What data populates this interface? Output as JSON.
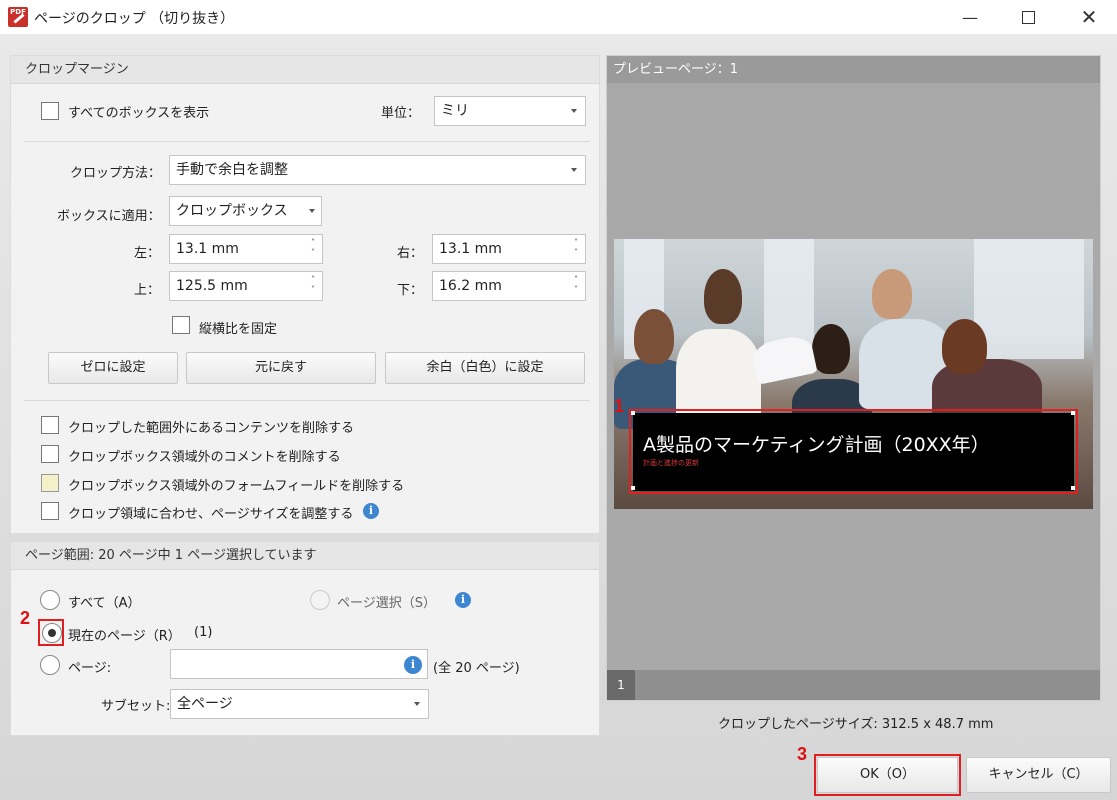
{
  "window": {
    "title": "ページのクロップ （切り抜き）",
    "app_icon_text": "PDF"
  },
  "crop_margin": {
    "header": "クロップマージン",
    "show_all_boxes_label": "すべてのボックスを表示",
    "unit_label": "単位：",
    "unit_value": "ミリ",
    "crop_method_label": "クロップ方法：",
    "crop_method_value": "手動で余白を調整",
    "apply_box_label": "ボックスに適用：",
    "apply_box_value": "クロップボックス",
    "left_label": "左：",
    "left_value": "13.1 mm",
    "right_label": "右：",
    "right_value": "13.1 mm",
    "top_label": "上：",
    "top_value": "125.5 mm",
    "bottom_label": "下：",
    "bottom_value": "16.2 mm",
    "keep_ratio_label": "縦横比を固定",
    "btn_zero": "ゼロに設定",
    "btn_reset": "元に戻す",
    "btn_white": "余白（白色）に設定",
    "opt1": "クロップした範囲外にあるコンテンツを削除する",
    "opt2": "クロップボックス領域外のコメントを削除する",
    "opt3": "クロップボックス領域外のフォームフィールドを削除する",
    "opt4": "クロップ領域に合わせ、ページサイズを調整する"
  },
  "page_range": {
    "header": "ページ範囲: 20 ページ中 1 ページ選択しています",
    "all_label": "すべて（A）",
    "select_label": "ページ選択（S）",
    "current_label": "現在のページ（R）",
    "current_count": "(1)",
    "pages_label": "ページ:",
    "pages_input": "",
    "pages_total": "(全 20 ページ)",
    "subset_label": "サブセット:",
    "subset_value": "全ページ",
    "selected": "current"
  },
  "preview": {
    "header": "プレビューページ：1",
    "slide_title": "A製品のマーケティング計画（20XX年）",
    "slide_subtitle": "計画と進捗の更新",
    "thumb_number": "1",
    "cropped_size": "クロップしたページサイズ: 312.5 x 48.7 mm"
  },
  "footer": {
    "ok": "OK（O）",
    "cancel": "キャンセル（C）"
  },
  "annotations": {
    "badge1": "1",
    "badge2": "2",
    "badge3": "3",
    "highlight_color": "#e02020"
  }
}
